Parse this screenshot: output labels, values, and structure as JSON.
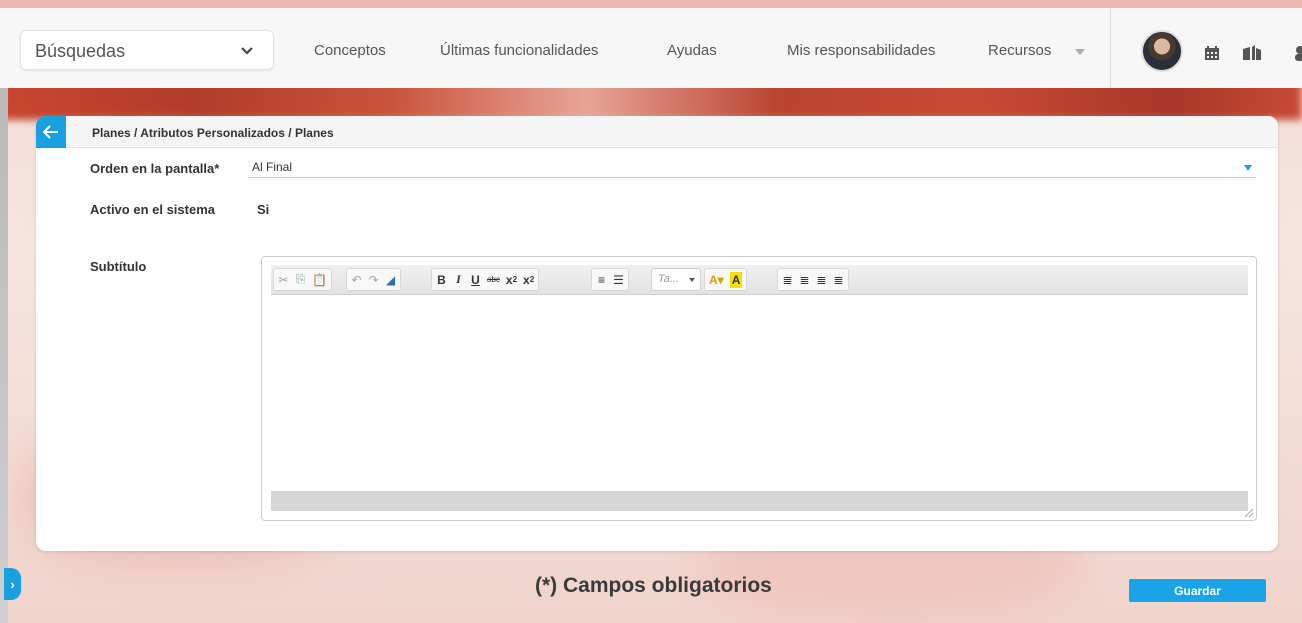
{
  "header": {
    "search_label": "Búsquedas",
    "nav": [
      "Conceptos",
      "Últimas funcionalidades",
      "Ayudas",
      "Mis responsabilidades",
      "Recursos"
    ]
  },
  "breadcrumb": "Planes / Atributos Personalizados / Planes",
  "form": {
    "order_label": "Orden en la pantalla*",
    "order_value": "Al Final",
    "active_label": "Activo en el sistema",
    "active_value": "Si",
    "subtitle_label": "Subtítulo"
  },
  "editor": {
    "style_combo": "Ta...",
    "toolbar_buttons": [
      "cut",
      "copy",
      "paste",
      "undo",
      "redo",
      "remove-format",
      "bold",
      "italic",
      "underline",
      "strikethrough",
      "subscript",
      "superscript",
      "numbered-list",
      "bulleted-list",
      "text-color",
      "background-color",
      "align-left",
      "align-center",
      "align-right",
      "justify"
    ]
  },
  "footer": {
    "required_note": "(*) Campos obligatorios",
    "save_label": "Guardar"
  },
  "colors": {
    "accent": "#1a9fe0",
    "brand_red": "#c8462f"
  }
}
